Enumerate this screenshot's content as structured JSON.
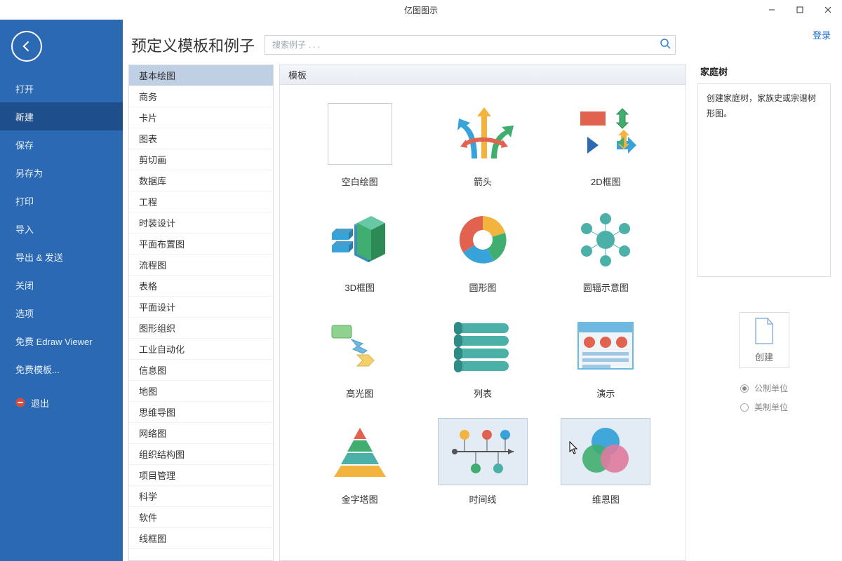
{
  "window": {
    "title": "亿图图示"
  },
  "login_label": "登录",
  "sidebar": {
    "items": [
      {
        "label": "打开"
      },
      {
        "label": "新建"
      },
      {
        "label": "保存"
      },
      {
        "label": "另存为"
      },
      {
        "label": "打印"
      },
      {
        "label": "导入"
      },
      {
        "label": "导出 & 发送"
      },
      {
        "label": "关闭"
      },
      {
        "label": "选项"
      },
      {
        "label": "免费 Edraw Viewer"
      },
      {
        "label": "免费模板..."
      }
    ],
    "active_index": 1,
    "exit_label": "退出"
  },
  "heading": "预定义模板和例子",
  "search": {
    "placeholder": "搜索例子 . . ."
  },
  "categories": [
    "基本绘图",
    "商务",
    "卡片",
    "图表",
    "剪切画",
    "数据库",
    "工程",
    "时装设计",
    "平面布置图",
    "流程图",
    "表格",
    "平面设计",
    "图形组织",
    "工业自动化",
    "信息图",
    "地图",
    "思维导图",
    "网络图",
    "组织结构图",
    "项目管理",
    "科学",
    "软件",
    "线框图"
  ],
  "selected_category_index": 0,
  "templates_header": "模板",
  "templates": [
    {
      "label": "空白绘图",
      "icon": "blank"
    },
    {
      "label": "箭头",
      "icon": "arrows"
    },
    {
      "label": "2D框图",
      "icon": "2dblock"
    },
    {
      "label": "3D框图",
      "icon": "3dblock"
    },
    {
      "label": "圆形图",
      "icon": "circle"
    },
    {
      "label": "圆辐示意图",
      "icon": "radial"
    },
    {
      "label": "高光图",
      "icon": "highlight"
    },
    {
      "label": "列表",
      "icon": "list"
    },
    {
      "label": "演示",
      "icon": "presentation"
    },
    {
      "label": "金字塔图",
      "icon": "pyramid"
    },
    {
      "label": "时间线",
      "icon": "timeline"
    },
    {
      "label": "维恩图",
      "icon": "venn"
    }
  ],
  "selected_template_indices": [
    10,
    11
  ],
  "right_panel": {
    "title": "家庭树",
    "description": "创建家庭树，家族史或宗谱树形图。",
    "create_label": "创建",
    "units": [
      {
        "label": "公制单位",
        "checked": true
      },
      {
        "label": "美制单位",
        "checked": false
      }
    ]
  }
}
